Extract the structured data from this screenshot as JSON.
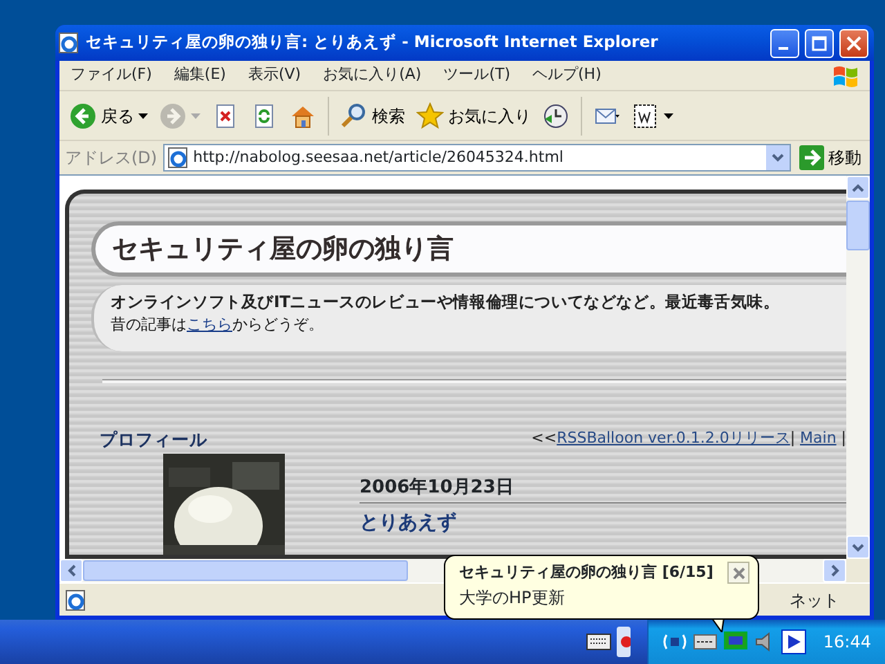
{
  "window": {
    "title": "セキュリティ屋の卵の独り言: とりあえず - Microsoft Internet Explorer"
  },
  "menu": [
    "ファイル(F)",
    "編集(E)",
    "表示(V)",
    "お気に入り(A)",
    "ツール(T)",
    "ヘルプ(H)"
  ],
  "toolbar": [
    {
      "kind": "back",
      "label": "戻る",
      "disabled": false
    },
    {
      "kind": "forward",
      "disabled": true
    },
    {
      "kind": "stop"
    },
    {
      "kind": "refresh"
    },
    {
      "kind": "home"
    },
    {
      "kind": "search",
      "label": "検索"
    },
    {
      "kind": "favorites",
      "label": "お気に入り"
    },
    {
      "kind": "history"
    },
    {
      "kind": "mail"
    },
    {
      "kind": "edit"
    }
  ],
  "address": {
    "label": "アドレス(D)",
    "value": "http://nabolog.seesaa.net/article/26045324.html",
    "go": "移動"
  },
  "page": {
    "blog_title": "セキュリティ屋の卵の独り言",
    "description": "オンラインソフト及びITニュースのレビューや情報倫理についてなどなど。最近毒舌気味。",
    "old_posts": {
      "before": "昔の記事は",
      "link": "こちら",
      "after": "からどうぞ。"
    },
    "profile_heading": "プロフィール",
    "nav": {
      "prefix": "<<",
      "link": "RSSBalloon ver.0.1.2.0リリース",
      "sep": "|",
      "main": "Main",
      "end": "|"
    },
    "date": "2006年10月23日",
    "article_title": "とりあえず"
  },
  "status_bar": {
    "zone": "ネット"
  },
  "balloon": {
    "title": "セキュリティ屋の卵の独り言 [6/15]",
    "body": "大学のHP更新"
  },
  "taskbar": {
    "clock": "16:44"
  }
}
